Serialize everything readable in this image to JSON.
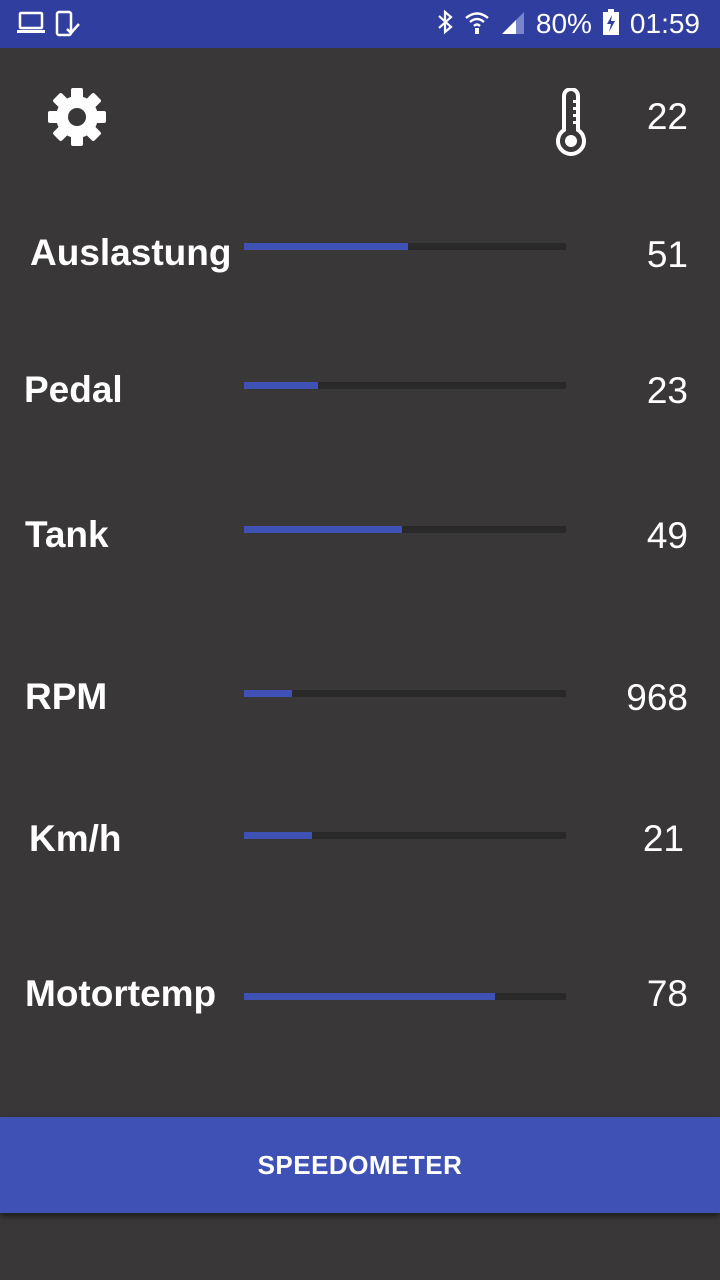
{
  "status_bar": {
    "battery_percent": "80%",
    "time": "01:59",
    "icons": [
      "laptop-icon",
      "device-check-icon",
      "bluetooth-icon",
      "wifi-icon",
      "signal-icon",
      "battery-charging-icon"
    ]
  },
  "header": {
    "settings_icon": "gear-icon",
    "temperature_icon": "thermometer-icon",
    "temperature_value": "22"
  },
  "metrics": [
    {
      "label": "Auslastung",
      "value": "51",
      "fill_fraction": 0.51
    },
    {
      "label": "Pedal",
      "value": "23",
      "fill_fraction": 0.23
    },
    {
      "label": "Tank",
      "value": "49",
      "fill_fraction": 0.49
    },
    {
      "label": "RPM",
      "value": "968",
      "fill_fraction": 0.15
    },
    {
      "label": "Km/h",
      "value": "21",
      "fill_fraction": 0.21
    },
    {
      "label": "Motortemp",
      "value": "78",
      "fill_fraction": 0.78
    }
  ],
  "footer": {
    "button_label": "SPEEDOMETER"
  },
  "colors": {
    "accent": "#3f51b5",
    "status_bar": "#303f9f",
    "background": "#393738",
    "track": "#2a292a"
  }
}
